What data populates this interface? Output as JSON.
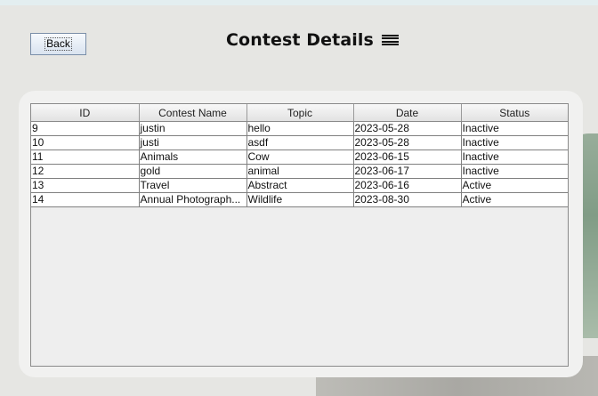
{
  "window": {
    "title": "Contest Details"
  },
  "toolbar": {
    "back_label": "Back",
    "menu_icon": "hamburger-menu-icon"
  },
  "table": {
    "columns": [
      "ID",
      "Contest Name",
      "Topic",
      "Date",
      "Status"
    ],
    "rows": [
      [
        "9",
        "justin",
        "hello",
        "2023-05-28",
        "Inactive"
      ],
      [
        "10",
        "justi",
        "asdf",
        "2023-05-28",
        "Inactive"
      ],
      [
        "11",
        "Animals",
        "Cow",
        "2023-06-15",
        "Inactive"
      ],
      [
        "12",
        "gold",
        "animal",
        "2023-06-17",
        "Inactive"
      ],
      [
        "13",
        "Travel",
        "Abstract",
        "2023-06-16",
        "Active"
      ],
      [
        "14",
        "Annual Photograph...",
        "Wildlife",
        "2023-08-30",
        "Active"
      ]
    ]
  }
}
